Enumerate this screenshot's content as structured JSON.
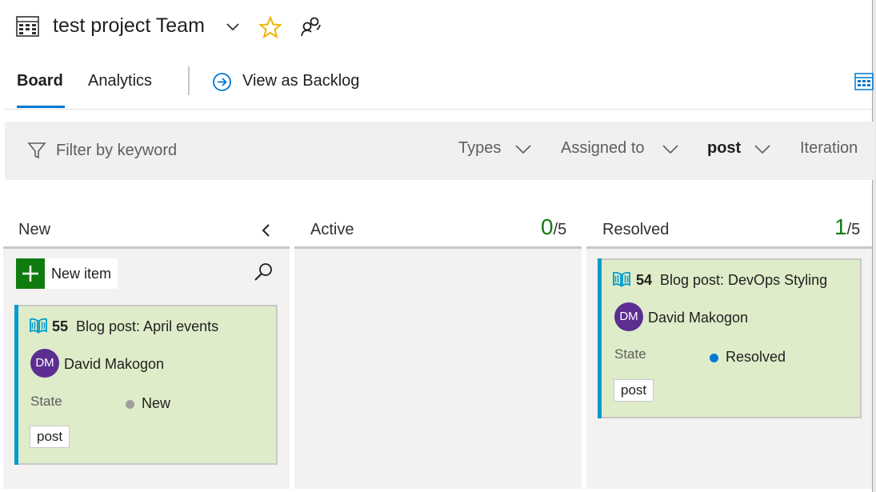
{
  "header": {
    "team_title": "test project Team",
    "icons": [
      "board-icon",
      "chevron-down-icon",
      "star-icon",
      "team-members-icon"
    ],
    "favorite_color": "#f0b400"
  },
  "tabs": {
    "board": "Board",
    "analytics": "Analytics",
    "backlog": "View as Backlog",
    "active_color": "#0078d4"
  },
  "filter": {
    "placeholder": "Filter by keyword",
    "pills": {
      "types": "Types",
      "assigned": "Assigned to",
      "tag": "post",
      "iteration": "Iteration"
    }
  },
  "columns": {
    "new": {
      "title": "New"
    },
    "active": {
      "title": "Active",
      "count": "0",
      "limit": "/5"
    },
    "resolved": {
      "title": "Resolved",
      "count": "1",
      "limit": "/5"
    }
  },
  "new_item": {
    "label": "New item",
    "color": "#107c10"
  },
  "cards": [
    {
      "id": "55",
      "title": "Blog post: April events",
      "avatar": "DM",
      "assignee": "David Makogon",
      "state_label": "State",
      "state": "New",
      "state_color": "#a19f9d",
      "tag": "post"
    },
    {
      "id": "54",
      "title": "Blog post: DevOps Styling",
      "avatar": "DM",
      "assignee": "David Makogon",
      "state_label": "State",
      "state": "Resolved",
      "state_color": "#0078d4",
      "tag": "post"
    }
  ],
  "colors": {
    "card_bg": "#deecc9",
    "card_accent": "#009ccc",
    "avatar": "#5c2e91",
    "wip_count": "#107c10"
  }
}
